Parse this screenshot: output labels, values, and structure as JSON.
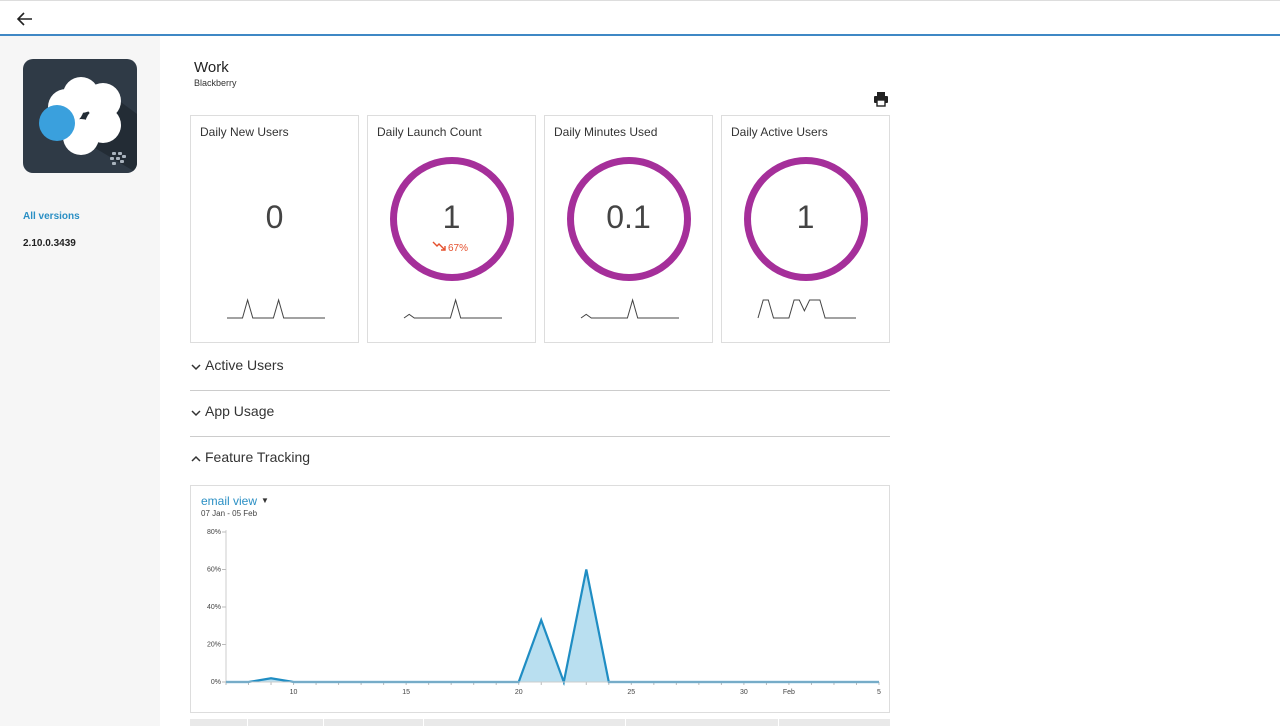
{
  "header": {
    "back_icon": "arrow-left-icon"
  },
  "sidebar": {
    "app_icon": "blackberry-work-app-icon",
    "all_versions_label": "All versions",
    "version": "2.10.0.3439"
  },
  "app": {
    "title": "Work",
    "subtitle": "Blackberry",
    "print_icon": "printer-icon"
  },
  "colors": {
    "accent": "#2a8fc4",
    "ring": "#a52f9a",
    "delta_down": "#e5502d",
    "series": "#1f8dc3",
    "area": "#b9dff0"
  },
  "cards": [
    {
      "title": "Daily New Users",
      "value": "0",
      "ring": false,
      "delta": "",
      "spark": [
        0,
        0,
        0,
        0,
        1,
        0,
        0,
        0,
        0,
        0,
        1,
        0,
        0,
        0,
        0,
        0,
        0,
        0,
        0,
        0
      ]
    },
    {
      "title": "Daily Launch Count",
      "value": "1",
      "ring": true,
      "delta": "67%",
      "spark": [
        0,
        0.2,
        0,
        0,
        0,
        0,
        0,
        0,
        0,
        0,
        1,
        0,
        0,
        0,
        0,
        0,
        0,
        0,
        0,
        0
      ]
    },
    {
      "title": "Daily Minutes Used",
      "value": "0.1",
      "ring": true,
      "delta": "",
      "spark": [
        0,
        0.2,
        0,
        0,
        0,
        0,
        0,
        0,
        0,
        0,
        1,
        0,
        0,
        0,
        0,
        0,
        0,
        0,
        0,
        0
      ]
    },
    {
      "title": "Daily Active Users",
      "value": "1",
      "ring": true,
      "delta": "",
      "spark": [
        0,
        1,
        1,
        0,
        0,
        0,
        0,
        1,
        1,
        0.4,
        1,
        1,
        1,
        0,
        0,
        0,
        0,
        0,
        0,
        0
      ]
    }
  ],
  "sections": [
    {
      "label": "Active Users",
      "expanded": false
    },
    {
      "label": "App Usage",
      "expanded": false
    },
    {
      "label": "Feature Tracking",
      "expanded": true
    }
  ],
  "feature_chart": {
    "metric": "email view",
    "date_range": "07 Jan - 05 Feb"
  },
  "chart_data": {
    "type": "area",
    "title": "email view",
    "subtitle": "07 Jan - 05 Feb",
    "x": [
      "Jan 7",
      "Jan 8",
      "Jan 9",
      "Jan 10",
      "Jan 11",
      "Jan 12",
      "Jan 13",
      "Jan 14",
      "Jan 15",
      "Jan 16",
      "Jan 17",
      "Jan 18",
      "Jan 19",
      "Jan 20",
      "Jan 21",
      "Jan 22",
      "Jan 23",
      "Jan 24",
      "Jan 25",
      "Jan 26",
      "Jan 27",
      "Jan 28",
      "Jan 29",
      "Jan 30",
      "Jan 31",
      "Feb 1",
      "Feb 2",
      "Feb 3",
      "Feb 4",
      "Feb 5"
    ],
    "series": [
      {
        "values": [
          0,
          0,
          2,
          0,
          0,
          0,
          0,
          0,
          0,
          0,
          0,
          0,
          0,
          0,
          33,
          0,
          60,
          0,
          0,
          0,
          0,
          0,
          0,
          0,
          0,
          0,
          0,
          0,
          0,
          0
        ]
      }
    ],
    "x_tick_labels": [
      "10",
      "15",
      "20",
      "25",
      "30",
      "Feb",
      "5"
    ],
    "x_tick_index": [
      3,
      8,
      13,
      18,
      23,
      25,
      29
    ],
    "y_tick_labels": [
      "0%",
      "20%",
      "40%",
      "60%",
      "80%"
    ],
    "ylim": [
      0,
      80
    ],
    "grid": false
  }
}
